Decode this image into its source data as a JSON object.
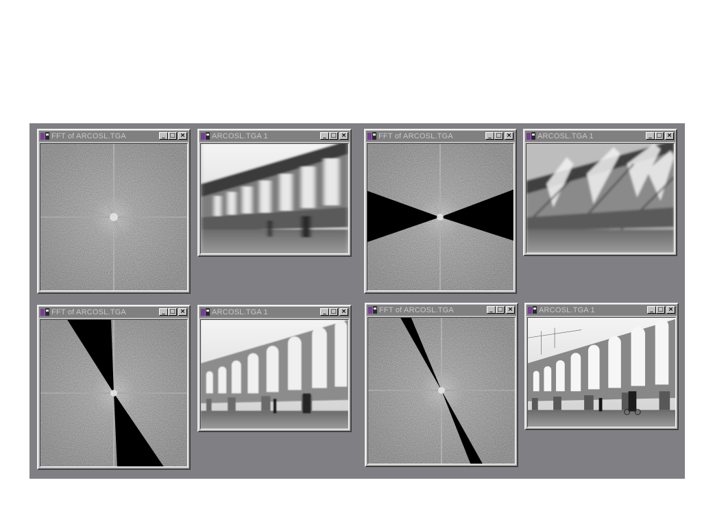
{
  "desktop": {
    "background_color": "#807f83"
  },
  "colors": {
    "active_title": "#00008a",
    "inactive_title": "#808080",
    "window_face": "#c0c0c0"
  },
  "icons": {
    "app": "image-app-icon",
    "minimize": "minimize-icon",
    "maximize": "maximize-icon",
    "close": "close-icon"
  },
  "windows": [
    {
      "title": "FFT of ARCOSL.TGA",
      "kind": "fft",
      "active": true,
      "mask": "none"
    },
    {
      "title": "ARCOSL.TGA 1",
      "kind": "image",
      "active": false,
      "variant": "blurred"
    },
    {
      "title": "FFT of ARCOSL.TGA",
      "kind": "fft",
      "active": false,
      "mask": "horizontal-wedges"
    },
    {
      "title": "ARCOSL.TGA 1",
      "kind": "image",
      "active": false,
      "variant": "streaked"
    },
    {
      "title": "FFT of ARCOSL.TGA",
      "kind": "fft",
      "active": false,
      "mask": "wide-diagonal-wedges"
    },
    {
      "title": "ARCOSL.TGA 1",
      "kind": "image",
      "active": false,
      "variant": "partially-sharp"
    },
    {
      "title": "FFT of ARCOSL.TGA",
      "kind": "fft",
      "active": false,
      "mask": "narrow-diagonal-wedges"
    },
    {
      "title": "ARCOSL.TGA 1",
      "kind": "image",
      "active": false,
      "variant": "sharp"
    }
  ]
}
